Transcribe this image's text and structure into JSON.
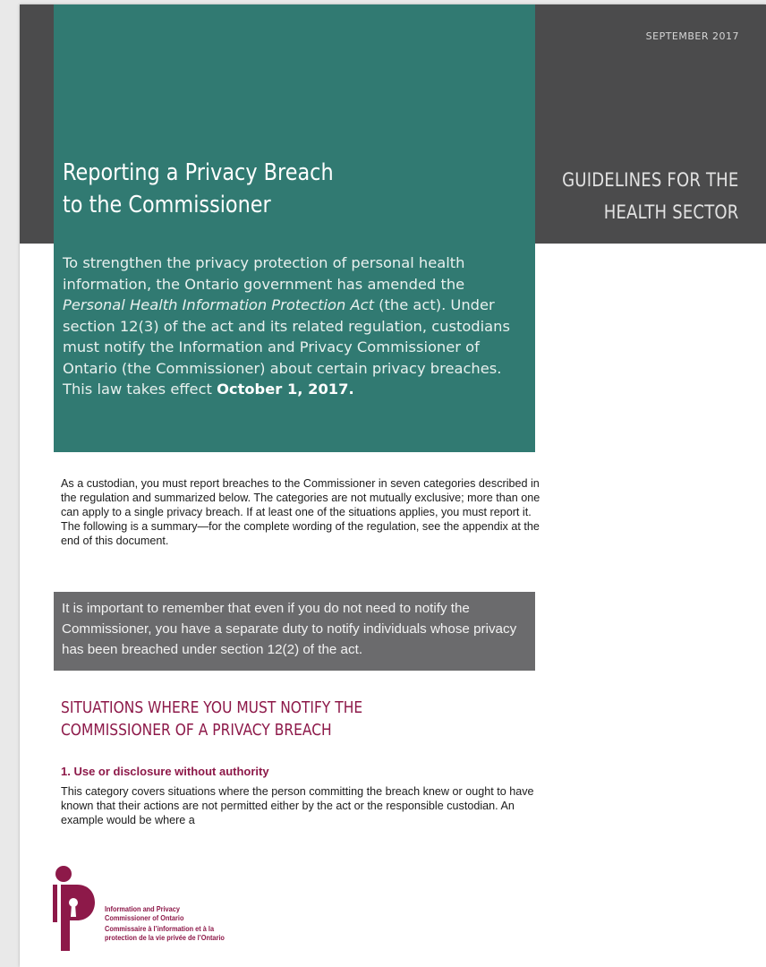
{
  "header": {
    "date": "SEPTEMBER 2017",
    "guidelines_line1": "GUIDELINES FOR THE",
    "guidelines_line2": "HEALTH SECTOR"
  },
  "title": {
    "line1": "Reporting a Privacy Breach",
    "line2": "to the Commissioner"
  },
  "intro": {
    "part1": "To strengthen the privacy protection of personal health information, the Ontario government has amended the ",
    "act_name": "Personal Health Information Protection Act",
    "part2": " (the act). Under section 12(3) of the act and its related regulation, custodians must notify the Information and Privacy Commissioner of Ontario (the Commissioner) about certain privacy breaches. This law takes effect ",
    "effective_date": "October 1, 2017",
    "part3": "."
  },
  "body": {
    "paragraph1": "As a custodian, you must report breaches to the Commissioner in seven categories described in the regulation and summarized below. The categories are not mutually exclusive; more than one can apply to a single privacy breach. If at least one of the situations applies, you must report it. The following is a summary—for the complete wording of the regulation, see the appendix at the end of this document.",
    "callout": "It is important to remember that even if you do not need to notify the Commissioner, you have a separate duty to notify individuals whose privacy has been breached under section 12(2) of the act.",
    "section_heading": "SITUATIONS WHERE YOU MUST NOTIFY THE COMMISSIONER OF A PRIVACY BREACH",
    "subheading": "1. Use or disclosure without authority",
    "paragraph2": "This category covers situations where the person committing the breach knew or ought to have known that their actions are not permitted either by the act or the responsible custodian. An example would be where a"
  },
  "logo": {
    "icon": "ipc-logo-icon",
    "en_line1": "Information and Privacy",
    "en_line2": "Commissioner of Ontario",
    "fr_line1": "Commissaire à l’information et à la",
    "fr_line2": "protection de la vie privée de l’Ontario"
  },
  "colors": {
    "teal": "#317a72",
    "charcoal": "#4b4b4c",
    "callout_gray": "#6b6b6d",
    "accent_maroon": "#8d1949"
  }
}
